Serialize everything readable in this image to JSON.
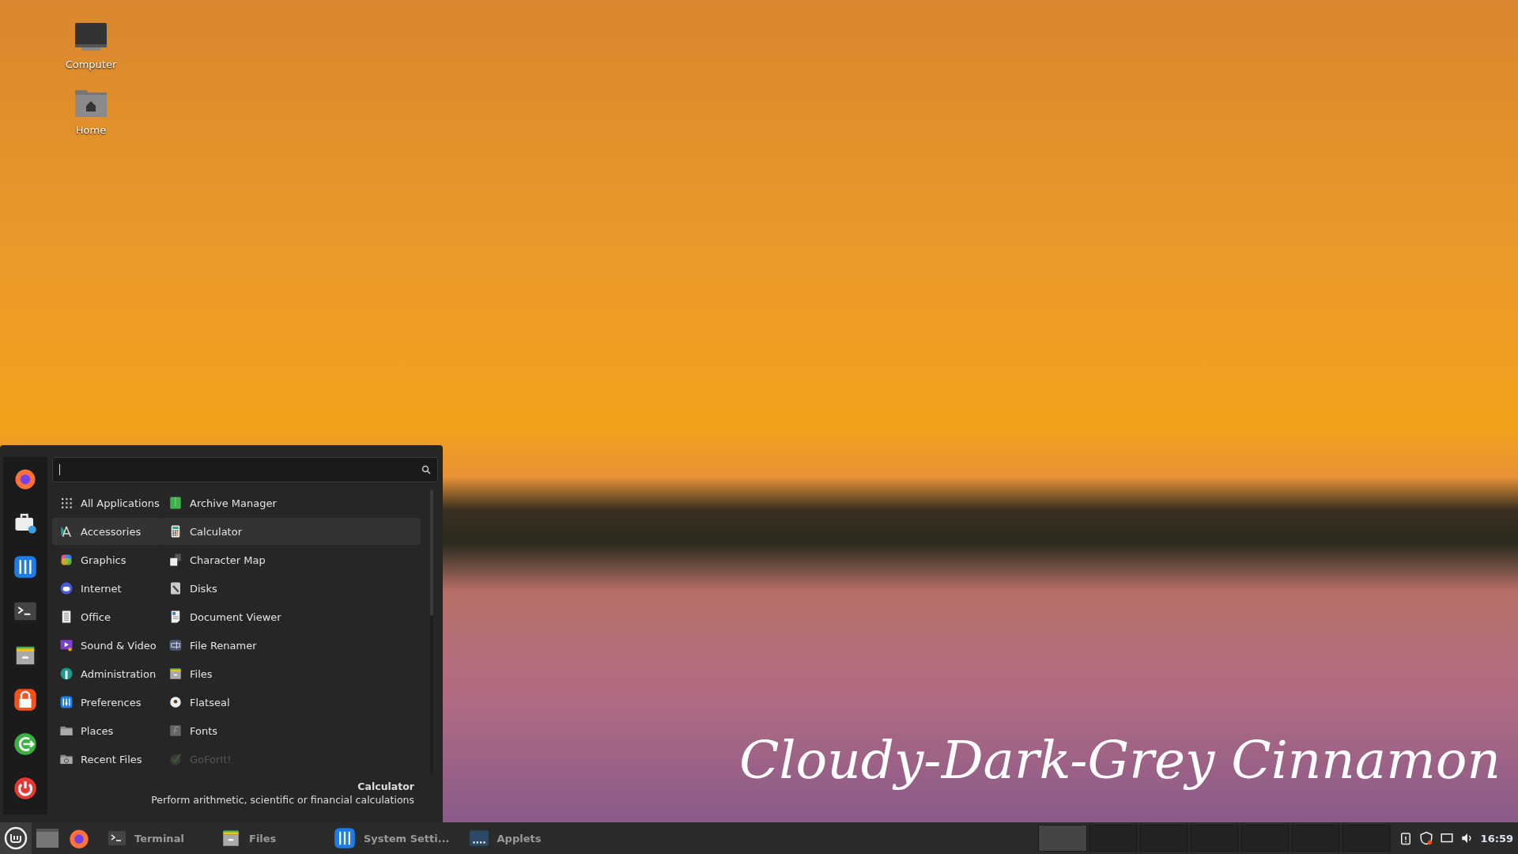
{
  "desktop_icons": [
    {
      "label": "Computer",
      "kind": "computer"
    },
    {
      "label": "Home",
      "kind": "home"
    }
  ],
  "caption": "Cloudy-Dark-Grey Cinnamon",
  "menu": {
    "categories": [
      {
        "label": "All Applications",
        "kind": "all",
        "selected": false
      },
      {
        "label": "Accessories",
        "kind": "accessories",
        "selected": true
      },
      {
        "label": "Graphics",
        "kind": "graphics",
        "selected": false
      },
      {
        "label": "Internet",
        "kind": "internet",
        "selected": false
      },
      {
        "label": "Office",
        "kind": "office",
        "selected": false
      },
      {
        "label": "Sound & Video",
        "kind": "media",
        "selected": false
      },
      {
        "label": "Administration",
        "kind": "admin",
        "selected": false
      },
      {
        "label": "Preferences",
        "kind": "prefs",
        "selected": false
      },
      {
        "label": "Places",
        "kind": "folder",
        "selected": false
      },
      {
        "label": "Recent Files",
        "kind": "recent",
        "selected": false
      }
    ],
    "apps": [
      {
        "label": "Archive Manager",
        "kind": "archive",
        "selected": false,
        "disabled": false
      },
      {
        "label": "Calculator",
        "kind": "calculator",
        "selected": true,
        "disabled": false
      },
      {
        "label": "Character Map",
        "kind": "charmap",
        "selected": false,
        "disabled": false
      },
      {
        "label": "Disks",
        "kind": "disks",
        "selected": false,
        "disabled": false
      },
      {
        "label": "Document Viewer",
        "kind": "docviewer",
        "selected": false,
        "disabled": false
      },
      {
        "label": "File Renamer",
        "kind": "renamer",
        "selected": false,
        "disabled": false
      },
      {
        "label": "Files",
        "kind": "files",
        "selected": false,
        "disabled": false
      },
      {
        "label": "Flatseal",
        "kind": "flatseal",
        "selected": false,
        "disabled": false
      },
      {
        "label": "Fonts",
        "kind": "fonts",
        "selected": false,
        "disabled": false
      },
      {
        "label": "GoForIt!",
        "kind": "goforit",
        "selected": false,
        "disabled": true
      }
    ],
    "info": {
      "title": "Calculator",
      "description": "Perform arithmetic, scientific or financial calculations"
    }
  },
  "taskbar": {
    "windows": [
      {
        "label": "Terminal",
        "kind": "terminal"
      },
      {
        "label": "Files",
        "kind": "files"
      },
      {
        "label": "System Setti...",
        "kind": "settings"
      },
      {
        "label": "Applets",
        "kind": "applets"
      }
    ],
    "workspaces": [
      {
        "selected": true
      },
      {
        "selected": false
      },
      {
        "selected": false
      },
      {
        "selected": false
      },
      {
        "selected": false
      },
      {
        "selected": false
      },
      {
        "selected": false
      }
    ],
    "clock": "16:59"
  }
}
